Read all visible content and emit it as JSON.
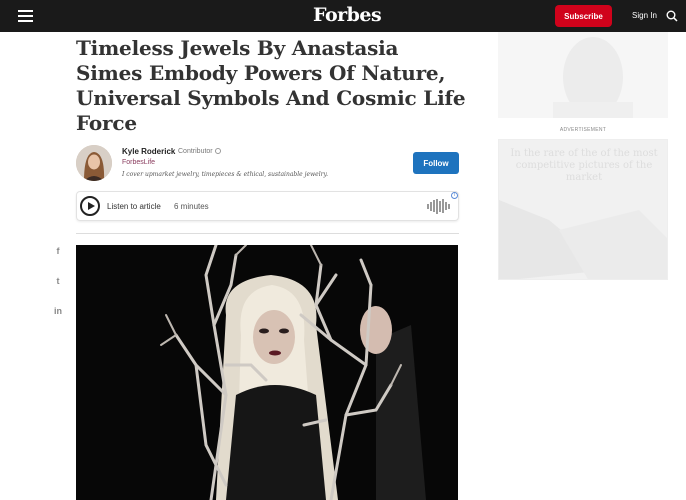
{
  "nav": {
    "logo": "Forbes",
    "subscribe_label": "Subscribe",
    "signin_label": "Sign In"
  },
  "article": {
    "headline": "Timeless Jewels By Anastasia Simes Embody Powers Of Nature, Universal Symbols And Cosmic Life Force",
    "author": {
      "name": "Kyle Roderick",
      "role": "Contributor",
      "section": "ForbesLife",
      "bio": "I cover upmarket jewelry, timepieces & ethical, sustainable jewelry."
    },
    "follow_label": "Follow",
    "listen": {
      "label": "Listen to article",
      "duration": "6 minutes"
    }
  },
  "social": [
    "f",
    "t",
    "in"
  ],
  "rail": {
    "ad_label": "ADVERTISEMENT",
    "ad_text": "In the rare of the of the most competitive pictures of the market"
  },
  "colors": {
    "nav_bg": "#1a1a1a",
    "subscribe": "#d0021b",
    "follow": "#1e73be",
    "section_link": "#8a3c5e"
  }
}
